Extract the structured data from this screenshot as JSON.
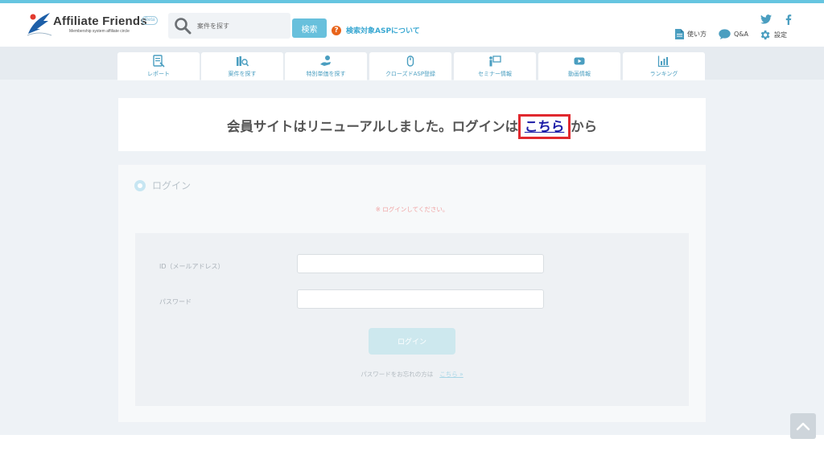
{
  "brand": {
    "name": "Affiliate Friends",
    "badge": "Beta",
    "subtitle": "Membership system affiliate circle"
  },
  "search": {
    "placeholder": "案件を探す",
    "button_label": "検索"
  },
  "asp_link": {
    "label": "検索対象ASPについて",
    "icon": "question-icon"
  },
  "social": [
    {
      "name": "twitter",
      "icon": "twitter-icon"
    },
    {
      "name": "facebook",
      "icon": "facebook-icon"
    }
  ],
  "utility_nav": [
    {
      "label": "使い方",
      "icon": "document-icon"
    },
    {
      "label": "Q&A",
      "icon": "speech-bubble-icon"
    },
    {
      "label": "設定",
      "icon": "gear-icon"
    }
  ],
  "nav_tabs": [
    {
      "label": "レポート",
      "icon": "report-icon"
    },
    {
      "label": "案件を探す",
      "icon": "books-search-icon"
    },
    {
      "label": "特別単価を探す",
      "icon": "hand-coin-icon"
    },
    {
      "label": "クローズドASP登録",
      "icon": "mouse-icon"
    },
    {
      "label": "セミナー情報",
      "icon": "presentation-icon"
    },
    {
      "label": "動画情報",
      "icon": "play-icon"
    },
    {
      "label": "ランキング",
      "icon": "chart-icon"
    }
  ],
  "notice": {
    "before": "会員サイトはリニューアルしました。ログインは ",
    "link": "こちら",
    "after": " から"
  },
  "login": {
    "title": "ログイン",
    "error": "※ ログインしてください。",
    "id_label": "ID（メールアドレス）",
    "id_value": "",
    "password_label": "パスワード",
    "password_value": "",
    "submit_label": "ログイン",
    "forgot_text": "パスワードをお忘れの方は",
    "forgot_link": "こちら »"
  },
  "colors": {
    "accent": "#66c5e0",
    "link": "#3aa8d2",
    "highlight": "#e0282e",
    "warning": "#e8641b"
  }
}
